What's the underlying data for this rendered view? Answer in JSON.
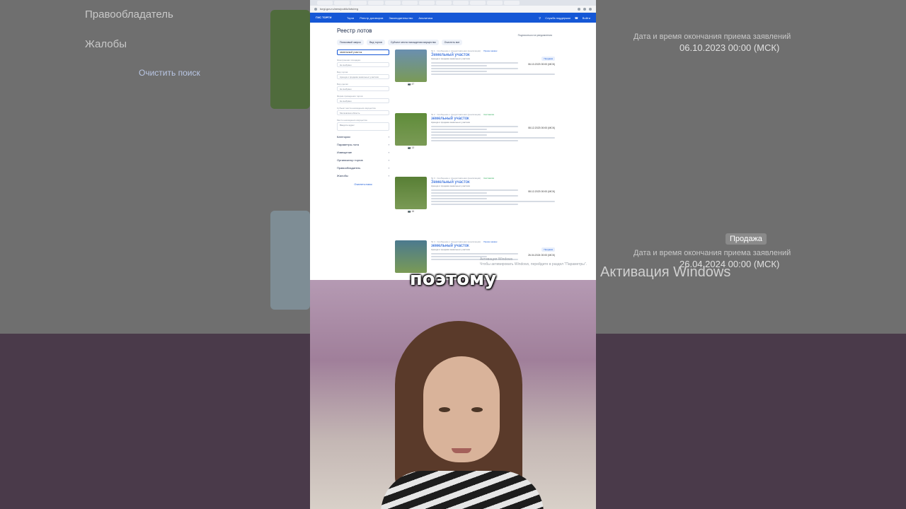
{
  "browser": {
    "url": "torgi.gov.ru/new/public/lots/reg"
  },
  "site": {
    "logo": "ГИС ТОРГИ",
    "nav": [
      "Торги",
      "Реестр договоров",
      "Законодательство",
      "Аналитика"
    ],
    "support": "Служба поддержки",
    "login": "Войти"
  },
  "page": {
    "title": "Реестр лотов",
    "subscribe": "Подписаться на уведомления",
    "filters": [
      "Поисковый запрос",
      "Вид торгов",
      "Субъект места нахождения имущества",
      "Очистить все"
    ]
  },
  "sidebar": {
    "search_value": "земельный участок",
    "fields": [
      {
        "label": "Электронная площадка",
        "value": "Не выбрано"
      },
      {
        "label": "Вид торгов",
        "value": "Аренда и продажа земельных участков"
      },
      {
        "label": "Вид сделки",
        "value": "Не выбрано"
      },
      {
        "label": "Форма проведения торгов",
        "value": "Не выбрано"
      },
      {
        "label": "Субъект места нахождения имущества",
        "value": "Московская область"
      },
      {
        "label": "Место нахождения имущества",
        "value": "Введите адрес"
      }
    ],
    "sections": [
      "Категории",
      "Параметры лота",
      "Извещение",
      "Организатор торгов",
      "Правообладатель",
      "Жалобы"
    ],
    "clear": "Очистить поиск"
  },
  "lots": [
    {
      "meta": "№ 1 · Сообщение о предоставлении (реализации)",
      "tag": "Прием заявок",
      "title": "Земельный участок",
      "sub": "Аренда и продажа земельных участков",
      "badge": "Продажа",
      "date": "06.10.2023 00:00 (МСК)",
      "photos": "47",
      "photo_color": "#6a8fb0"
    },
    {
      "meta": "№ 2 · Сообщение о предоставлении (реализации)",
      "tag": "Состоялся",
      "title": "земельный участок",
      "sub": "Аренда и продажа земельных участков",
      "badge": "",
      "date": "08.12.2023 00:00 (МСК)",
      "photos": "13",
      "photo_color": "#5f8c3a"
    },
    {
      "meta": "№ 3 · Сообщение о предоставлении (реализации)",
      "tag": "Состоялся",
      "title": "Земельный участок",
      "sub": "Аренда и продажа земельных участков",
      "badge": "",
      "date": "08.12.2023 00:00 (МСК)",
      "photos": "16",
      "photo_color": "#587f35"
    },
    {
      "meta": "№ 4 · Сообщение о предоставлении (реализации)",
      "tag": "Прием заявок",
      "title": "земельный участок",
      "sub": "Аренда и продажа земельных участков",
      "badge": "Продажа",
      "date": "26.04.2024 00:00 (МСК)",
      "photos": "",
      "photo_color": "#4b7a8f"
    }
  ],
  "background": {
    "left_items": [
      "Правообладатель",
      "Жалобы",
      "Очистить поиск"
    ],
    "right_items": [
      "Дата и время окончания приема заявлений",
      "06.10.2023 00:00 (МСК)",
      "Продажа",
      "Дата и время окончания приема заявлений",
      "26.04.2024 00:00 (МСК)"
    ],
    "windows_activation": "Активация Windows"
  },
  "overlay": {
    "watermark_line1": "Активация Windows",
    "watermark_line2": "Чтобы активировать Windows, перейдите в раздел \"Параметры\".",
    "caption": "поэтому"
  }
}
